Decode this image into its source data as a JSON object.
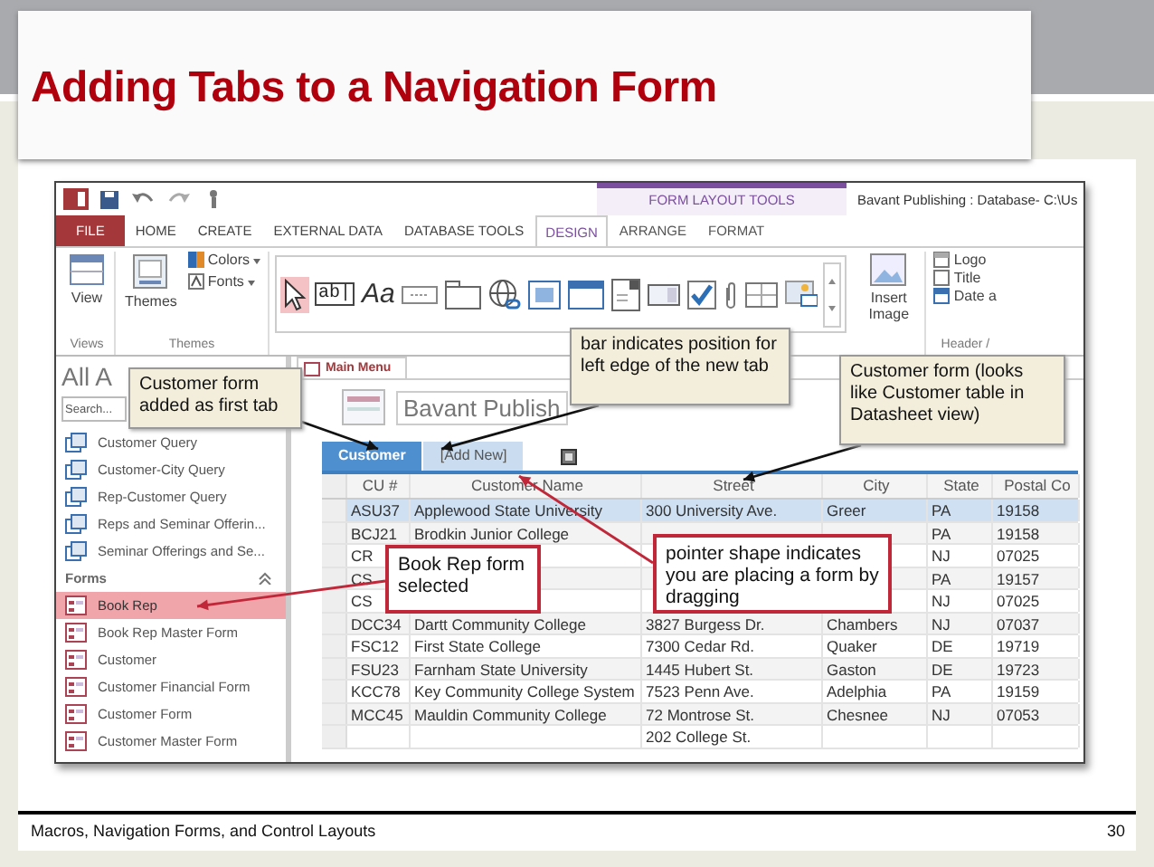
{
  "slide": {
    "title": "Adding Tabs to a Navigation Form",
    "footer": "Macros, Navigation Forms, and Control Layouts",
    "page_number": "30"
  },
  "app": {
    "window_title": "Bavant Publishing : Database- C:\\Us",
    "contextual_group": "FORM LAYOUT TOOLS",
    "ribbon_tabs": [
      {
        "label": "FILE",
        "kind": "file",
        "selected": false
      },
      {
        "label": "HOME",
        "kind": "standard",
        "selected": false
      },
      {
        "label": "CREATE",
        "kind": "standard",
        "selected": false
      },
      {
        "label": "EXTERNAL DATA",
        "kind": "standard",
        "selected": false
      },
      {
        "label": "DATABASE TOOLS",
        "kind": "standard",
        "selected": false
      },
      {
        "label": "DESIGN",
        "kind": "contextual",
        "selected": true
      },
      {
        "label": "ARRANGE",
        "kind": "contextual",
        "selected": false
      },
      {
        "label": "FORMAT",
        "kind": "contextual",
        "selected": false
      }
    ],
    "ribbon": {
      "view": "View",
      "views_group": "Views",
      "themes": "Themes",
      "colors": "Colors",
      "fonts": "Fonts",
      "themes_group": "Themes",
      "controls": [
        {
          "kind": "pointer",
          "selected": true
        },
        {
          "kind": "textbox",
          "label": "ab|",
          "selected": false
        },
        {
          "kind": "label",
          "label": "Aa",
          "selected": false
        },
        {
          "kind": "button",
          "selected": false
        },
        {
          "kind": "tab",
          "selected": false
        },
        {
          "kind": "hyperlink",
          "selected": false
        },
        {
          "kind": "web",
          "selected": false
        },
        {
          "kind": "navigation",
          "selected": false
        },
        {
          "kind": "combo",
          "selected": false
        },
        {
          "kind": "listbox",
          "selected": false
        },
        {
          "kind": "checkbox",
          "selected": false
        },
        {
          "kind": "attachment",
          "selected": false
        },
        {
          "kind": "option",
          "selected": false
        },
        {
          "kind": "image",
          "selected": false
        }
      ],
      "insert_image": "Insert Image",
      "header_items": [
        {
          "label": "Logo",
          "kind": "logo"
        },
        {
          "label": "Title",
          "kind": "title"
        },
        {
          "label": "Date a",
          "kind": "date"
        }
      ],
      "header_group": "Header /"
    }
  },
  "nav_pane": {
    "heading": "All A",
    "search": {
      "placeholder": "Search..."
    },
    "items": [
      {
        "label": "Customer Query",
        "kind": "query",
        "selected": false
      },
      {
        "label": "Customer-City Query",
        "kind": "query",
        "selected": false
      },
      {
        "label": "Rep-Customer Query",
        "kind": "query",
        "selected": false
      },
      {
        "label": "Reps and Seminar Offerin...",
        "kind": "query",
        "selected": false
      },
      {
        "label": "Seminar Offerings and Se...",
        "kind": "query",
        "selected": false
      },
      {
        "label": "Forms",
        "kind": "section"
      },
      {
        "label": "Book Rep",
        "kind": "form",
        "selected": true
      },
      {
        "label": "Book Rep Master Form",
        "kind": "form",
        "selected": false
      },
      {
        "label": "Customer",
        "kind": "form",
        "selected": false
      },
      {
        "label": "Customer Financial Form",
        "kind": "form",
        "selected": false
      },
      {
        "label": "Customer Form",
        "kind": "form",
        "selected": false
      },
      {
        "label": "Customer Master Form",
        "kind": "form",
        "selected": false
      }
    ]
  },
  "document": {
    "tab": "Main Menu",
    "form_title": "Bavant Publish",
    "nav_tabs": [
      {
        "label": "Customer",
        "selected": true
      },
      {
        "label": "[Add New]",
        "selected": false
      }
    ],
    "table": {
      "columns": [
        "CU #",
        "Customer Name",
        "Street",
        "City",
        "State",
        "Postal Co"
      ],
      "rows": [
        {
          "selected": true,
          "cells": [
            "ASU37",
            "Applewood State University",
            "300 University Ave.",
            "Greer",
            "PA",
            "19158"
          ]
        },
        {
          "selected": false,
          "cells": [
            "BCJ21",
            "Brodkin Junior College",
            null,
            null,
            "PA",
            "19158"
          ]
        },
        {
          "selected": false,
          "cells": [
            "CR",
            null,
            null,
            null,
            "NJ",
            "07025"
          ]
        },
        {
          "selected": false,
          "cells": [
            "CS",
            null,
            null,
            null,
            "PA",
            "19157"
          ]
        },
        {
          "selected": false,
          "cells": [
            "CS",
            null,
            null,
            null,
            "NJ",
            "07025"
          ]
        },
        {
          "selected": false,
          "cells": [
            "DCC34",
            "Dartt Community College",
            "3827 Burgess Dr.",
            "Chambers",
            "NJ",
            "07037"
          ]
        },
        {
          "selected": false,
          "cells": [
            "FSC12",
            "First State College",
            "7300 Cedar Rd.",
            "Quaker",
            "DE",
            "19719"
          ]
        },
        {
          "selected": false,
          "cells": [
            "FSU23",
            "Farnham State University",
            "1445 Hubert St.",
            "Gaston",
            "DE",
            "19723"
          ]
        },
        {
          "selected": false,
          "cells": [
            "KCC78",
            "Key Community College System",
            "7523 Penn Ave.",
            "Adelphia",
            "PA",
            "19159"
          ]
        },
        {
          "selected": false,
          "cells": [
            "MCC45",
            "Mauldin Community College",
            "72 Montrose St.",
            "Chesnee",
            "NJ",
            "07053"
          ]
        },
        {
          "selected": false,
          "cells": [
            null,
            null,
            "202 College St.",
            null,
            null,
            null
          ]
        }
      ]
    }
  },
  "callouts": [
    {
      "text": "Customer form added as first tab",
      "kind": "note"
    },
    {
      "text": "bar indicates position for left edge of the new tab",
      "kind": "note"
    },
    {
      "text": "Customer form (looks like Customer table in Datasheet view)",
      "kind": "note"
    },
    {
      "text": "Book Rep form selected",
      "kind": "highlight"
    },
    {
      "text": "pointer shape indicates you are placing a form by dragging",
      "kind": "highlight"
    }
  ]
}
